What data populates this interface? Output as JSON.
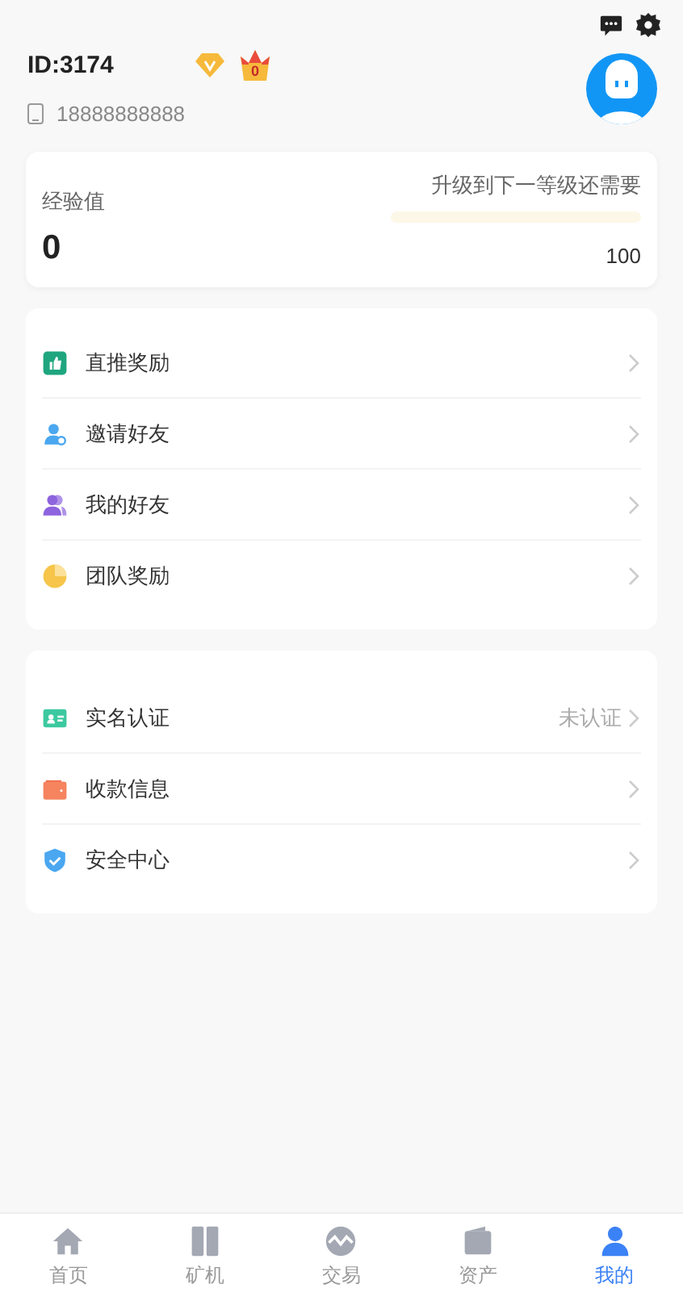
{
  "user": {
    "id": "ID:3174",
    "crown_level": "0",
    "phone": "18888888888"
  },
  "experience": {
    "label": "经验值",
    "value": "0",
    "next_label": "升级到下一等级还需要",
    "level": 0,
    "target": "100"
  },
  "menu_groups": [
    {
      "items": [
        {
          "kind": "thumb",
          "label": "直推奖励"
        },
        {
          "kind": "invite",
          "label": "邀请好友"
        },
        {
          "kind": "friends",
          "label": "我的好友"
        },
        {
          "kind": "pie",
          "label": "团队奖励"
        }
      ]
    },
    {
      "items": [
        {
          "kind": "idcard",
          "label": "实名认证",
          "status": "未认证"
        },
        {
          "kind": "wallet",
          "label": "收款信息"
        },
        {
          "kind": "shield",
          "label": "安全中心"
        }
      ]
    }
  ],
  "tabs": [
    {
      "kind": "home",
      "label": "首页",
      "selected": false
    },
    {
      "kind": "miner",
      "label": "矿机",
      "selected": false
    },
    {
      "kind": "trade",
      "label": "交易",
      "selected": false
    },
    {
      "kind": "assets",
      "label": "资产",
      "selected": false
    },
    {
      "kind": "me",
      "label": "我的",
      "selected": true
    }
  ]
}
